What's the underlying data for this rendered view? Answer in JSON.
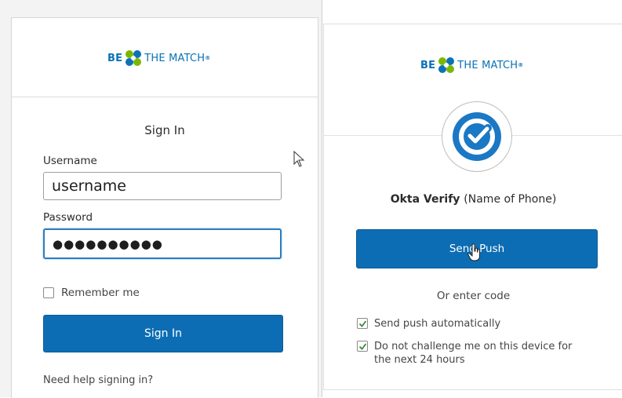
{
  "brand": {
    "be": "BE",
    "the_match": "THE MATCH",
    "tm": "®"
  },
  "signin": {
    "title": "Sign In",
    "username_label": "Username",
    "username_value": "username",
    "password_label": "Password",
    "password_value": "●●●●●●●●●●",
    "remember_label": "Remember me",
    "button_label": "Sign In",
    "help_link": "Need help signing in?"
  },
  "verify": {
    "factor_name": "Okta Verify",
    "factor_detail": "(Name of Phone)",
    "send_push_label": "Send Push",
    "or_enter_code": "Or enter code",
    "auto_push_label": "Send push automatically",
    "no_challenge_label_1": "Do not challenge me on this device for",
    "no_challenge_label_2": "the next 24 hours"
  },
  "colors": {
    "primary_button": "#0d6db4",
    "brand_blue": "#0b72b5",
    "brand_green": "#7ab800"
  },
  "icons": [
    "be-the-match-logo-icon",
    "okta-verify-icon",
    "checkmark-icon",
    "arrow-cursor-icon",
    "hand-cursor-icon"
  ]
}
